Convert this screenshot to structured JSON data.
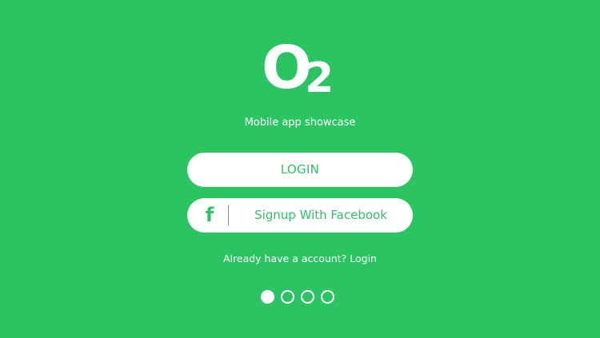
{
  "logo": {
    "letter": "O",
    "subscript": "2"
  },
  "tagline": "Mobile app showcase",
  "buttons": {
    "login_label": "LOGIN",
    "facebook_icon_glyph": "f",
    "facebook_label": "Signup With Facebook"
  },
  "footer": {
    "prompt": "Already have a account?",
    "login_link": "Login"
  },
  "pagination": {
    "total": 4,
    "active_index": 0
  },
  "colors": {
    "background": "#2bc462",
    "accent": "#2bc462",
    "button_bg": "#ffffff",
    "text": "#ffffff"
  }
}
